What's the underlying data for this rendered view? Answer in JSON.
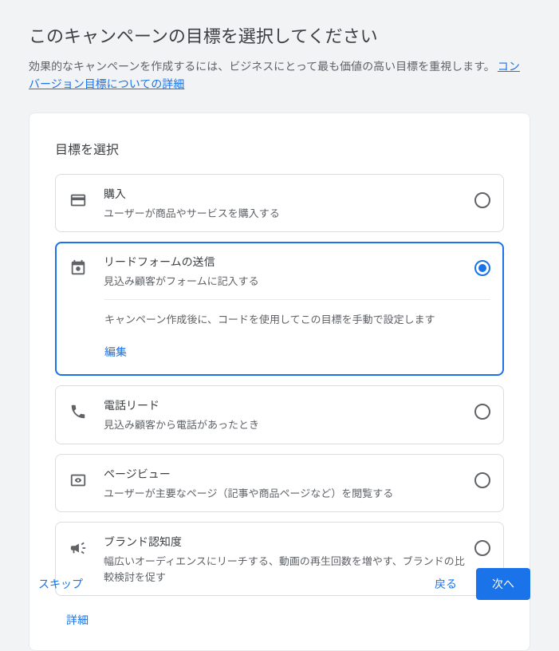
{
  "header": {
    "title": "このキャンペーンの目標を選択してください",
    "subtitle_prefix": "効果的なキャンペーンを作成するには、ビジネスにとって最も価値の高い目標を重視します。",
    "subtitle_link": "コンバージョン目標についての詳細"
  },
  "card": {
    "section_title": "目標を選択",
    "options": [
      {
        "icon": "credit-card-icon",
        "title": "購入",
        "desc": "ユーザーが商品やサービスを購入する",
        "selected": false
      },
      {
        "icon": "form-icon",
        "title": "リードフォームの送信",
        "desc": "見込み顧客がフォームに記入する",
        "selected": true,
        "body_text": "キャンペーン作成後に、コードを使用してこの目標を手動で設定します",
        "edit_label": "編集"
      },
      {
        "icon": "phone-icon",
        "title": "電話リード",
        "desc": "見込み顧客から電話があったとき",
        "selected": false
      },
      {
        "icon": "pageview-icon",
        "title": "ページビュー",
        "desc": "ユーザーが主要なページ（記事や商品ページなど）を閲覧する",
        "selected": false
      },
      {
        "icon": "megaphone-icon",
        "title": "ブランド認知度",
        "desc": "幅広いオーディエンスにリーチする、動画の再生回数を増やす、ブランドの比較検討を促す",
        "selected": false
      }
    ],
    "details_label": "詳細"
  },
  "footer": {
    "skip": "スキップ",
    "back": "戻る",
    "next": "次へ"
  }
}
